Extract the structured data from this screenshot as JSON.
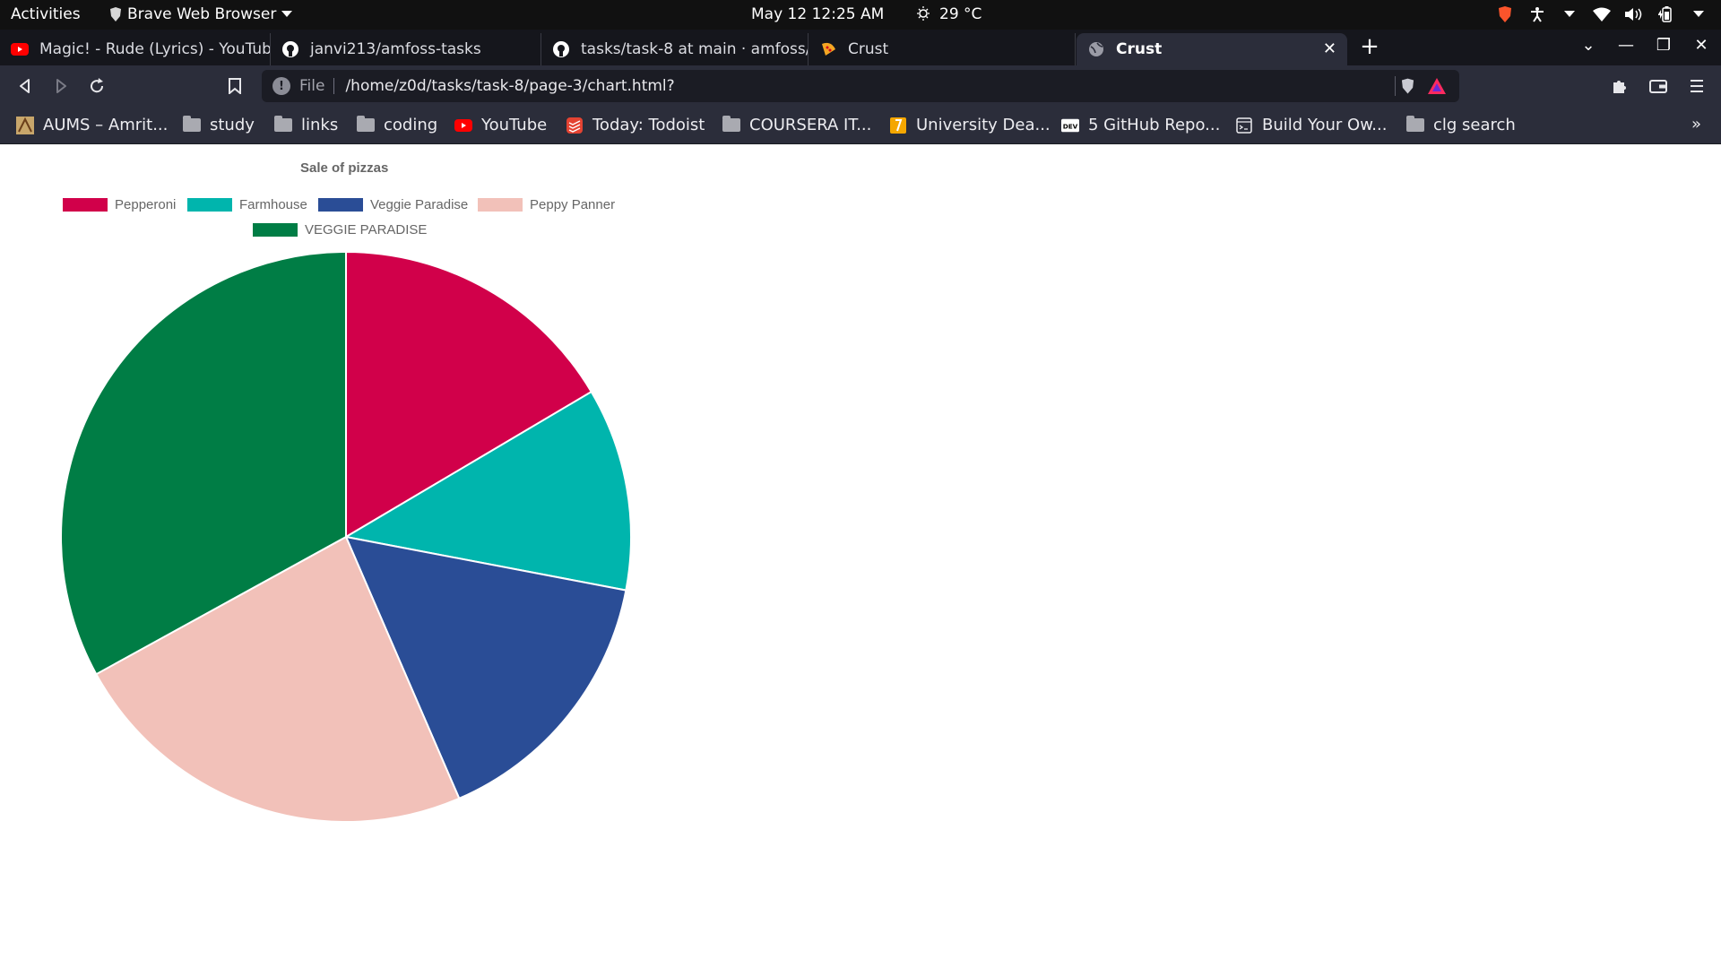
{
  "topbar": {
    "activities": "Activities",
    "app_name": "Brave Web Browser",
    "clock": "May 12  12:25 AM",
    "temperature": "29 °C"
  },
  "tabs": [
    {
      "title": "Magic! - Rude (Lyrics) - YouTube",
      "icon": "youtube-icon"
    },
    {
      "title": "janvi213/amfoss-tasks",
      "icon": "github-icon"
    },
    {
      "title": "tasks/task-8 at main · amfoss/tasks",
      "icon": "github-icon"
    },
    {
      "title": "Crust",
      "icon": "pizza-icon"
    },
    {
      "title": "Crust",
      "icon": "globe-icon",
      "active": true
    }
  ],
  "toolbar": {
    "scheme": "File",
    "url": "/home/z0d/tasks/task-8/page-3/chart.html?"
  },
  "bookmarks": [
    {
      "label": "AUMS – Amrit...",
      "icon": "aums-icon"
    },
    {
      "label": "study",
      "icon": "folder-icon"
    },
    {
      "label": "links",
      "icon": "folder-icon"
    },
    {
      "label": "coding",
      "icon": "folder-icon"
    },
    {
      "label": "YouTube",
      "icon": "youtube-icon"
    },
    {
      "label": "Today: Todoist",
      "icon": "todoist-icon"
    },
    {
      "label": "COURSERA IT...",
      "icon": "folder-icon"
    },
    {
      "label": "University Dea...",
      "icon": "university-icon"
    },
    {
      "label": "5 GitHub Repo...",
      "icon": "dev-icon"
    },
    {
      "label": "Build Your Ow...",
      "icon": "terminal-icon"
    },
    {
      "label": "clg search",
      "icon": "folder-icon"
    }
  ],
  "bookmarks_more": "»",
  "chart_data": {
    "type": "pie",
    "title": "Sale of pizzas",
    "legend_position": "top",
    "categories": [
      "Pepperoni",
      "Farmhouse",
      "Veggie Paradise",
      "Peppy Panner",
      "VEGGIE PARADISE"
    ],
    "values": [
      16.5,
      11.5,
      15.5,
      23.5,
      33
    ],
    "colors": [
      "#d1004a",
      "#00b5ad",
      "#2a4d96",
      "#f2c1b9",
      "#007d45"
    ]
  }
}
